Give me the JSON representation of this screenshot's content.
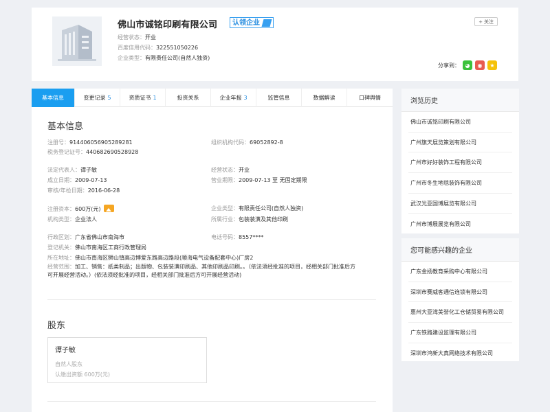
{
  "company": {
    "name": "佛山市诚铭印刷有限公司",
    "claim_badge": "认领企业",
    "status_label": "经营状态：",
    "status": "开业",
    "credit_label": "百度信用代码：",
    "credit_code": "322551050226",
    "type_label": "企业类型：",
    "type": "有限责任公司(自然人独资)"
  },
  "follow_label": "关注",
  "share_label": "分享到：",
  "tabs": [
    {
      "label": "基本信息",
      "count": ""
    },
    {
      "label": "变更记录",
      "count": "5"
    },
    {
      "label": "资质证书",
      "count": "1"
    },
    {
      "label": "投资关系",
      "count": ""
    },
    {
      "label": "企业年报",
      "count": "3"
    },
    {
      "label": "监管信息",
      "count": ""
    },
    {
      "label": "数据解读",
      "count": ""
    },
    {
      "label": "口碑舆情",
      "count": ""
    }
  ],
  "basic": {
    "title": "基本信息",
    "reg_no_label": "注册号：",
    "reg_no": "914406056905289281",
    "org_code_label": "组织机构代码：",
    "org_code": "69052892-8",
    "tax_label": "税务登记证号：",
    "tax_no": "440682690528928",
    "legal_label": "法定代表人：",
    "legal": "谭子敏",
    "op_status_label": "经营状态：",
    "op_status": "开业",
    "established_label": "成立日期：",
    "established": "2009-07-13",
    "term_label": "营业期限：",
    "term": "2009-07-13 至 无固定期限",
    "approve_label": "审核/年检日期：",
    "approve": "2016-06-28",
    "capital_label": "注册资本：",
    "capital": "600万(元)",
    "ent_type_label": "企业类型：",
    "ent_type": "有限责任公司(自然人独资)",
    "org_type_label": "机构类型：",
    "org_type": "企业法人",
    "industry_label": "所属行业：",
    "industry": "包装装潢及其他印刷",
    "region_label": "行政区划：",
    "region": "广东省佛山市南海市",
    "phone_label": "电话号码：",
    "phone": "8557****",
    "authority_label": "登记机关：",
    "authority": "佛山市南海区工商行政管理局",
    "address_label": "所在地址：",
    "address": "佛山市南海区狮山镇高边博爱东路高边路段(顺海电气设备配套中心)厂房2",
    "scope_label": "经营范围：",
    "scope_line1": "加工、销售：纸类制品；出版物、包装装潢印刷品、其他印刷品印刷。。（依法须经批准的项目，经相关部门批准后方",
    "scope_line2": "可开展经营活动。）(依法须经批准的项目，经相关部门批准后方可开展经营活动)"
  },
  "shareholders": {
    "title": "股东",
    "items": [
      {
        "name": "谭子敏",
        "type": "自然人股东",
        "amount": "认缴出资额 600万(元)"
      }
    ]
  },
  "history": {
    "title": "浏览历史",
    "items": [
      "佛山市诚铭印刷有限公司",
      "广州旗天展览策划有限公司",
      "广州市好好装饰工程有限公司",
      "广州市冬生地毯装饰有限公司",
      "武汉光亚国博展览有限公司",
      "广州市博展展览有限公司"
    ]
  },
  "interest": {
    "title": "您可能感兴趣的企业",
    "items": [
      "广东金扬教育采购中心有限公司",
      "深圳市赛威客通信连锁有限公司",
      "惠州大亚湾美誉化工仓储贸易有限公司",
      "广东铁路建设监理有限公司",
      "深圳市鸿新大真网络技术有限公司"
    ]
  }
}
